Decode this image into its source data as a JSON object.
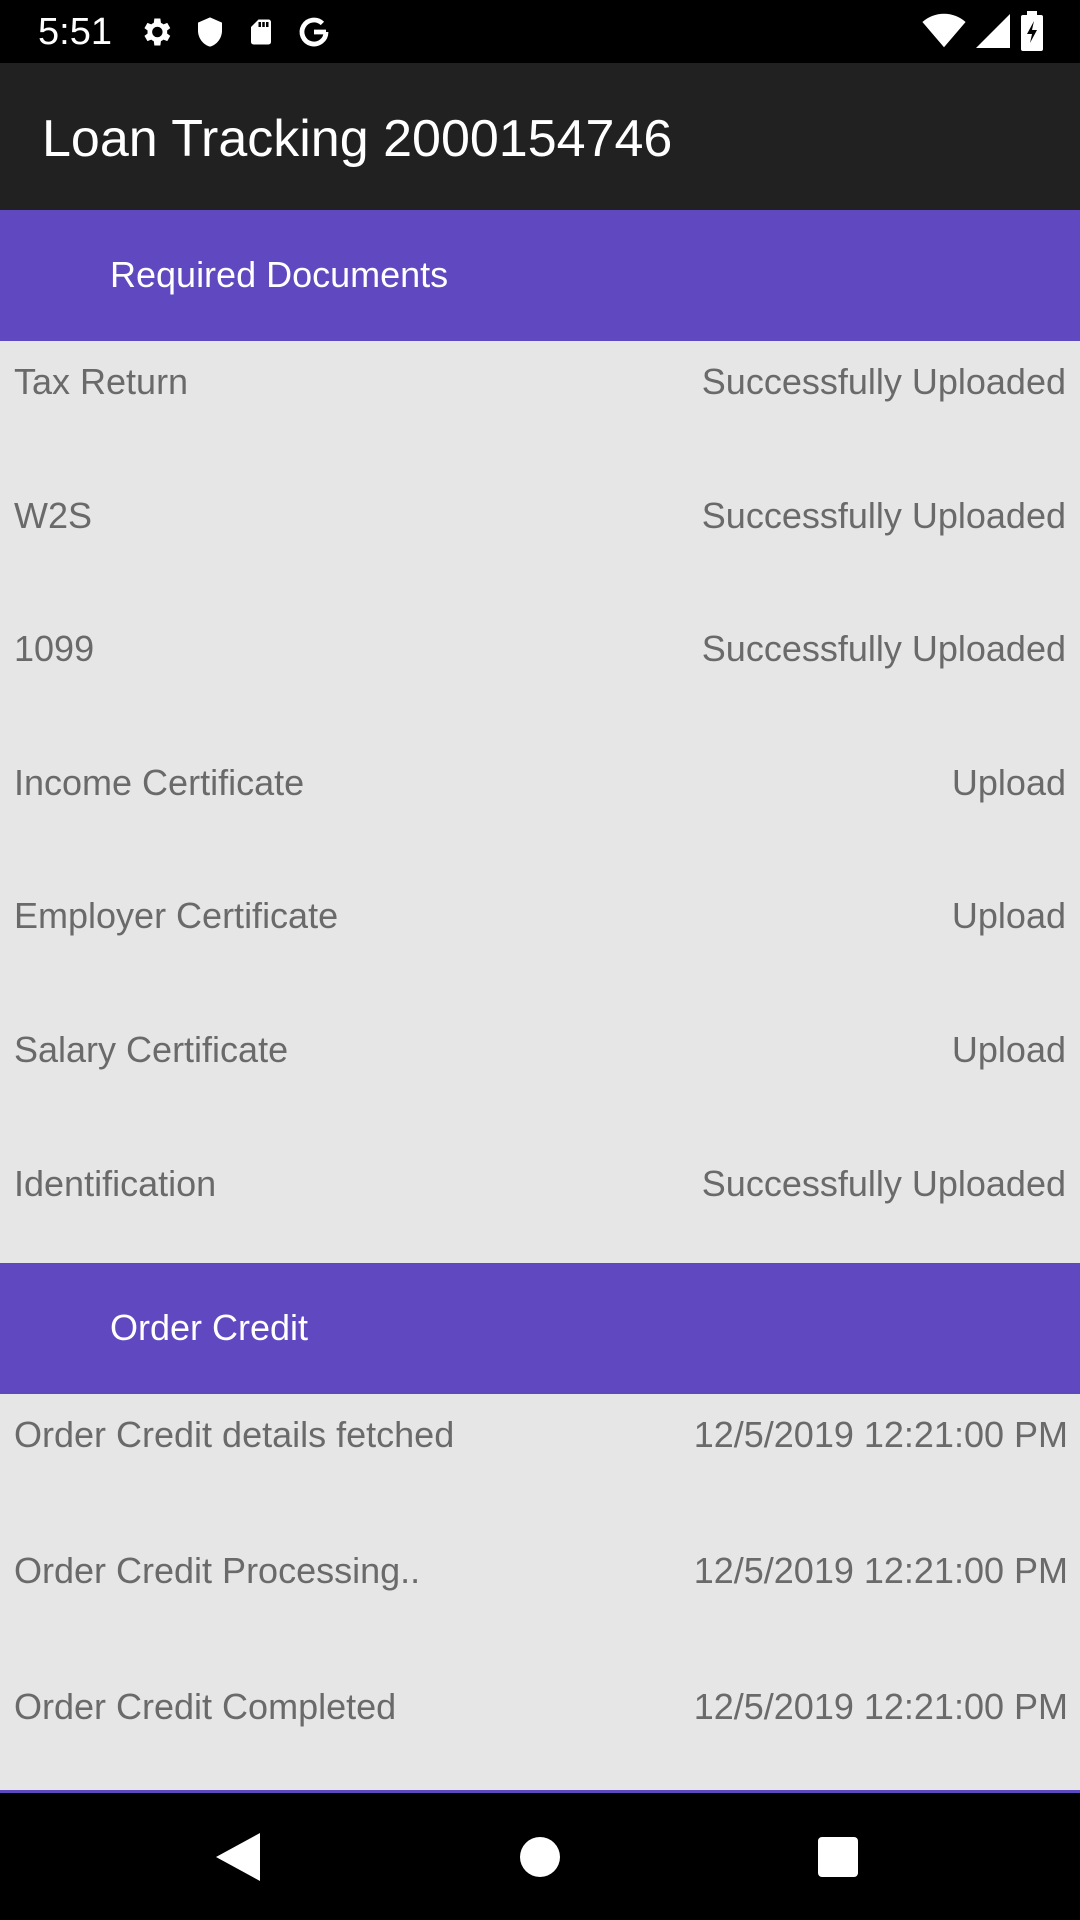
{
  "status_bar": {
    "time": "5:51",
    "left_icons": [
      "gear-icon",
      "shield-icon",
      "sd-card-icon",
      "google-icon"
    ],
    "right_icons": [
      "wifi-icon",
      "cellular-signal-icon",
      "battery-icon"
    ]
  },
  "app_bar": {
    "title": "Loan Tracking 2000154746"
  },
  "sections": {
    "required_documents": {
      "title": "Required Documents",
      "items": [
        {
          "label": "Tax Return",
          "status": "Successfully Uploaded"
        },
        {
          "label": "W2S",
          "status": "Successfully Uploaded"
        },
        {
          "label": "1099",
          "status": "Successfully Uploaded"
        },
        {
          "label": "Income Certificate",
          "status": "Upload"
        },
        {
          "label": "Employer Certificate",
          "status": "Upload"
        },
        {
          "label": "Salary Certificate",
          "status": "Upload"
        },
        {
          "label": "Identification",
          "status": "Successfully Uploaded"
        }
      ]
    },
    "order_credit": {
      "title": "Order Credit",
      "items": [
        {
          "label": "Order Credit details fetched",
          "timestamp": "12/5/2019 12:21:00 PM"
        },
        {
          "label": "Order Credit Processing..",
          "timestamp": "12/5/2019 12:21:00 PM"
        },
        {
          "label": "Order Credit Completed",
          "timestamp": "12/5/2019 12:21:00 PM"
        }
      ]
    }
  },
  "nav_bar": {
    "buttons": [
      "back-icon",
      "home-icon",
      "recents-icon"
    ]
  },
  "colors": {
    "section_header": "#5f48c0",
    "app_bar": "#212121",
    "background": "#e6e6e6",
    "text_muted": "#6a6a6a"
  }
}
